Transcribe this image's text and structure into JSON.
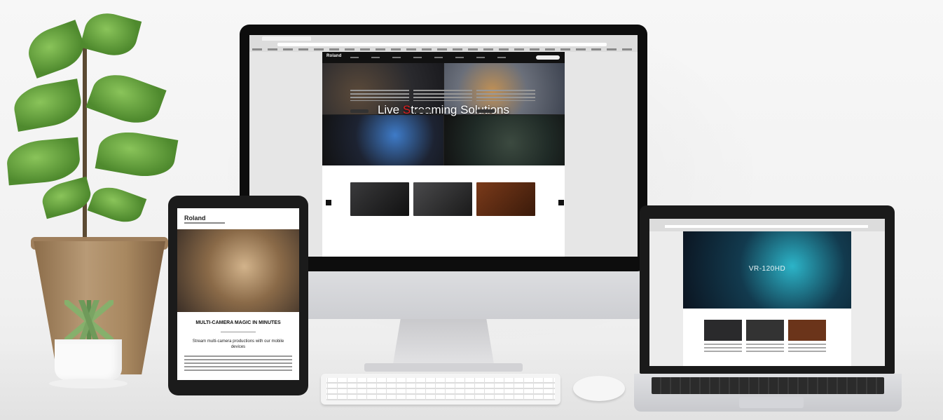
{
  "scene": {
    "description_alt": "",
    "colors": {
      "brand_red": "#e02020",
      "device_black": "#0d0d0d",
      "wall": "#f4f4f4"
    }
  },
  "imac": {
    "site": {
      "logo": "Roland",
      "hero_title_part1": "Live ",
      "hero_title_red": "S",
      "hero_title_part2": "treaming Solutions"
    }
  },
  "tablet": {
    "logo": "Roland",
    "headline": "MULTI-CAMERA MAGIC IN MINUTES",
    "lead": "Stream multi-camera productions with our mobile devices"
  },
  "laptop": {
    "hero_title": "VR-120HD"
  }
}
